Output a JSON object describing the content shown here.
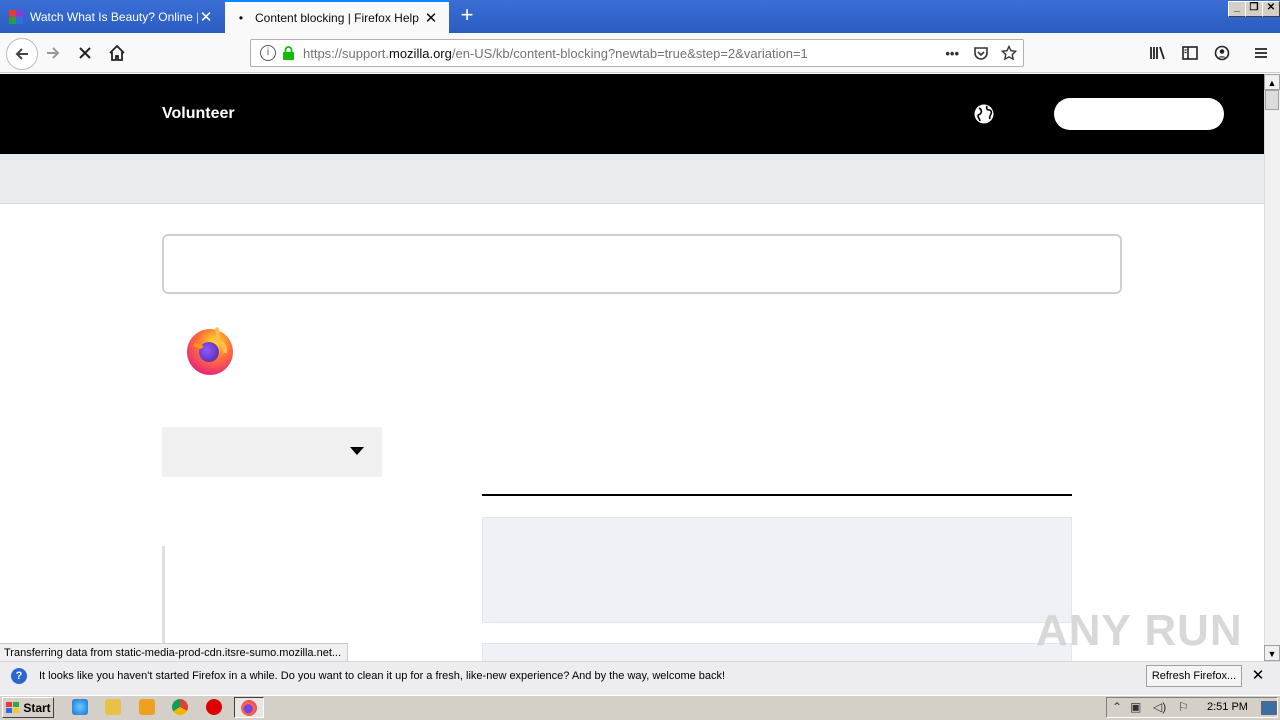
{
  "browser": {
    "tabs": [
      {
        "title": "Watch What Is Beauty? Online | W",
        "active": false
      },
      {
        "title": "Content blocking | Firefox Help",
        "active": true,
        "loading": true
      }
    ],
    "url": {
      "prefix": "https://support.",
      "domain": "mozilla.org",
      "path": "/en-US/kb/content-blocking?newtab=true&step=2&variation=1"
    },
    "new_tab_label": "+",
    "page_actions": "•••",
    "status_text": "Transferring data from static-media-prod-cdn.itsre-sumo.mozilla.net..."
  },
  "page": {
    "header": {
      "volunteer_label": "Volunteer"
    }
  },
  "watermark": "ANY RUN",
  "notification": {
    "message": "It looks like you haven't started Firefox in a while. Do you want to clean it up for a fresh, like-new experience? And by the way, welcome back!",
    "button_label": "Refresh Firefox..."
  },
  "taskbar": {
    "start_label": "Start",
    "clock": "2:51 PM"
  },
  "colors": {
    "accent": "#0a84ff",
    "titlebar": "#2a5cc0",
    "header_bg": "#000000",
    "subnav_bg": "#e8ecef",
    "card_bg": "#eef2f6"
  }
}
